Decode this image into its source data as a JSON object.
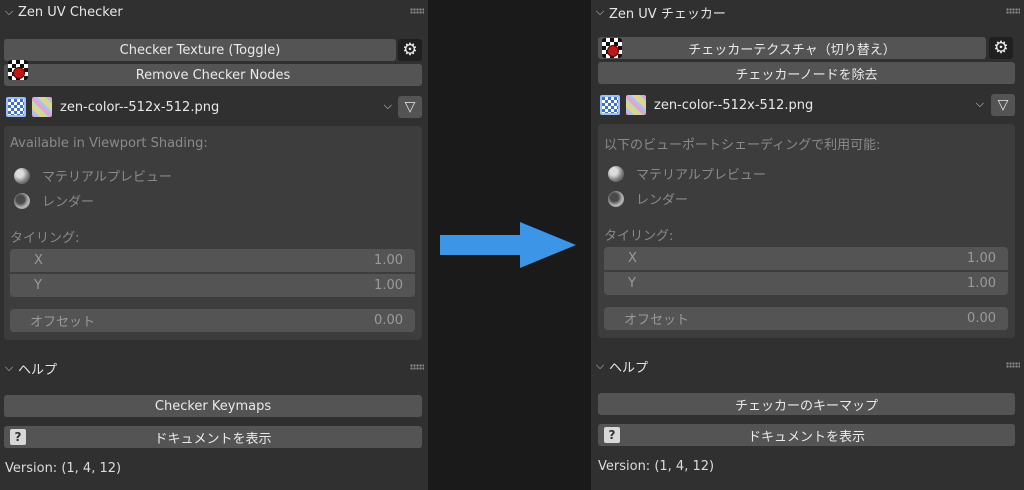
{
  "left": {
    "panel_title": "Zen UV Checker",
    "toggle_button": "Checker Texture (Toggle)",
    "remove_button": "Remove Checker Nodes",
    "texture_name": "zen-color--512x-512.png",
    "available_label": "Available in Viewport Shading:",
    "material_preview": "マテリアルプレビュー",
    "render": "レンダー",
    "tiling_label": "タイリング:",
    "x_label": "X",
    "x_value": "1.00",
    "y_label": "Y",
    "y_value": "1.00",
    "offset_label": "オフセット",
    "offset_value": "0.00",
    "help_title": "ヘルプ",
    "keymaps_button": "Checker Keymaps",
    "docs_button": "ドキュメントを表示",
    "version": "Version: (1, 4, 12)"
  },
  "right": {
    "panel_title": "Zen UV チェッカー",
    "toggle_button": "チェッカーテクスチャ（切り替え）",
    "remove_button": "チェッカーノードを除去",
    "texture_name": "zen-color--512x-512.png",
    "available_label": "以下のビューポートシェーディングで利用可能:",
    "material_preview": "マテリアルプレビュー",
    "render": "レンダー",
    "tiling_label": "タイリング:",
    "x_label": "X",
    "x_value": "1.00",
    "y_label": "Y",
    "y_value": "1.00",
    "offset_label": "オフセット",
    "offset_value": "0.00",
    "help_title": "ヘルプ",
    "keymaps_button": "チェッカーのキーマップ",
    "docs_button": "ドキュメントを表示",
    "version": "Version: (1, 4, 12)"
  },
  "icons": {
    "chevron": "chevron-down-icon",
    "checker": "checker-icon",
    "gear": "gear-icon",
    "filter": "filter-icon",
    "texture": "texture-icon",
    "material_ball": "material-preview-icon",
    "render_ball": "render-icon",
    "document": "help-document-icon",
    "arrow": "right-arrow"
  },
  "colors": {
    "background": "#1a1a1a",
    "panel": "#303030",
    "button": "#545454",
    "arrow": "#3d95e8"
  }
}
